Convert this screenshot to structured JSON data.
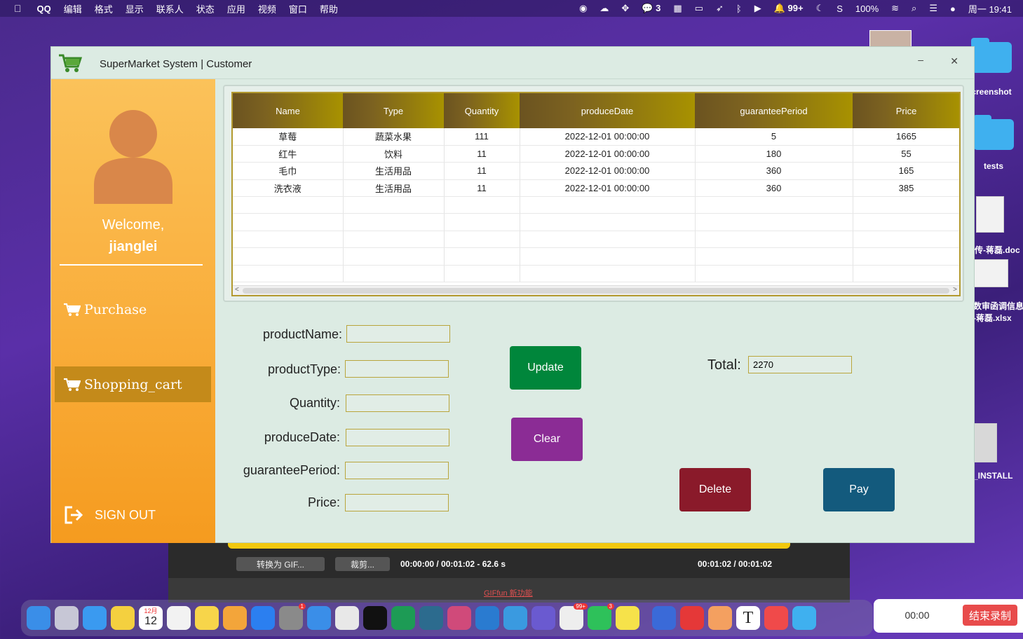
{
  "menubar": {
    "left": [
      "QQ",
      "编辑",
      "格式",
      "显示",
      "联系人",
      "状态",
      "应用",
      "视频",
      "窗口",
      "帮助"
    ],
    "wechat_count": "3",
    "notif_count": "99+",
    "battery": "100%",
    "clock": "周一 19:41"
  },
  "desktop": {
    "items": [
      "creenshot",
      "tests",
      "传-蒋磊.doc",
      "数审函调信息",
      "-蒋磊.xlsx",
      "_INSTALL"
    ]
  },
  "window": {
    "title": "SuperMarket System | Customer",
    "minimize": "–",
    "close": "✕"
  },
  "sidebar": {
    "welcome": "Welcome,",
    "username": "jianglei",
    "nav": [
      {
        "label": "Purchase"
      },
      {
        "label": "Shopping_cart"
      }
    ],
    "signout": "SIGN OUT"
  },
  "table": {
    "columns": [
      "Name",
      "Type",
      "Quantity",
      "produceDate",
      "guaranteePeriod",
      "Price"
    ],
    "rows": [
      [
        "草莓",
        "蔬菜水果",
        "111",
        "2022-12-01 00:00:00",
        "5",
        "1665"
      ],
      [
        "红牛",
        "饮料",
        "11",
        "2022-12-01 00:00:00",
        "180",
        "55"
      ],
      [
        "毛巾",
        "生活用品",
        "11",
        "2022-12-01 00:00:00",
        "360",
        "165"
      ],
      [
        "洗衣液",
        "生活用品",
        "11",
        "2022-12-01 00:00:00",
        "360",
        "385"
      ]
    ],
    "scroll_left": "<",
    "scroll_right": ">"
  },
  "form": {
    "productName": "productName:",
    "productType": "productType:",
    "quantity": "Quantity:",
    "produceDate": "produceDate:",
    "guaranteePeriod": "guaranteePeriod:",
    "price": "Price:"
  },
  "buttons": {
    "update": "Update",
    "clear": "Clear",
    "delete": "Delete",
    "pay": "Pay"
  },
  "total": {
    "label": "Total:",
    "value": "2270"
  },
  "gif_tool": {
    "convert": "转换为 GIF...",
    "crop": "裁剪...",
    "time_left": "00:00:00 / 00:01:02 - 62.6 s",
    "time_right": "00:01:02 / 00:01:02",
    "new_feature": "GIFfun 新功能"
  },
  "recorder": {
    "time": "00:00",
    "stop": "结束录制"
  },
  "dock": {
    "calendar_month": "12月",
    "calendar_day": "12",
    "badge_settings": "1",
    "badge_qq": "99+",
    "badge_wechat": "3"
  }
}
